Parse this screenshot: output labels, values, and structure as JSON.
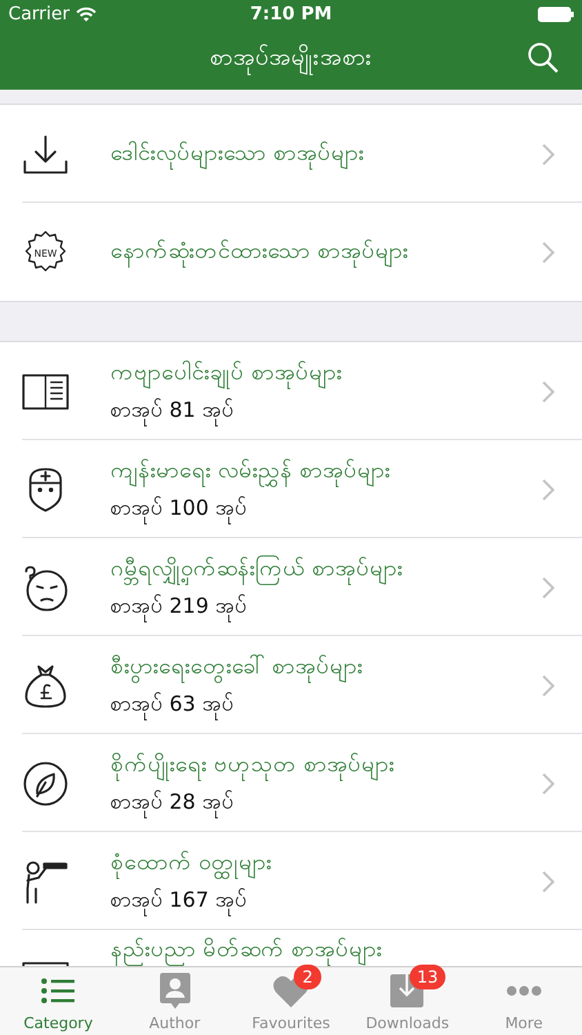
{
  "status_bar": {
    "carrier": "Carrier",
    "time": "7:10 PM"
  },
  "nav": {
    "title": "စာအုပ်အမျိုးအစား"
  },
  "featured": [
    {
      "kind": "download",
      "title": "ဒေါင်းလုပ်များသော စာအုပ်များ"
    },
    {
      "kind": "new",
      "title": "နောက်ဆုံးတင်ထားသော စာအုပ်များ",
      "icon_text": "NEW"
    }
  ],
  "categories": [
    {
      "kind": "book",
      "title": "ကဗျာပေါင်းချုပ် စာအုပ်များ",
      "count": "စာအုပ် 81 အုပ်"
    },
    {
      "kind": "doctor",
      "title": "ကျန်းမာရေး လမ်းညွှန် စာအုပ်များ",
      "count": "စာအုပ် 100 အုပ်"
    },
    {
      "kind": "puzzled",
      "title": "ဂမ္ဘီရလျှို့ဝှက်ဆန်းကြယ် စာအုပ်များ",
      "count": "စာအုပ် 219 အုပ်"
    },
    {
      "kind": "moneybag",
      "title": "စီးပွားရေးတွေးခေါ် စာအုပ်များ",
      "count": "စာအုပ် 63 အုပ်"
    },
    {
      "kind": "leaf",
      "title": "စိုက်ပျိုးရေး ဗဟုသုတ စာအုပ်များ",
      "count": "စာအုပ် 28 အုပ်"
    },
    {
      "kind": "detective",
      "title": "စုံထောက် ဝတ္ထုများ",
      "count": "စာအုပ် 167 အုပ်"
    },
    {
      "kind": "screen",
      "title": "နည်းပညာ မိတ်ဆက် စာအုပ်များ"
    }
  ],
  "tabs": [
    {
      "kind": "list",
      "label": "Category",
      "selected": true
    },
    {
      "kind": "author",
      "label": "Author",
      "selected": false
    },
    {
      "kind": "heart",
      "label": "Favourites",
      "selected": false,
      "badge": "2"
    },
    {
      "kind": "downloads",
      "label": "Downloads",
      "selected": false,
      "badge": "13"
    },
    {
      "kind": "more",
      "label": "More",
      "selected": false
    }
  ]
}
